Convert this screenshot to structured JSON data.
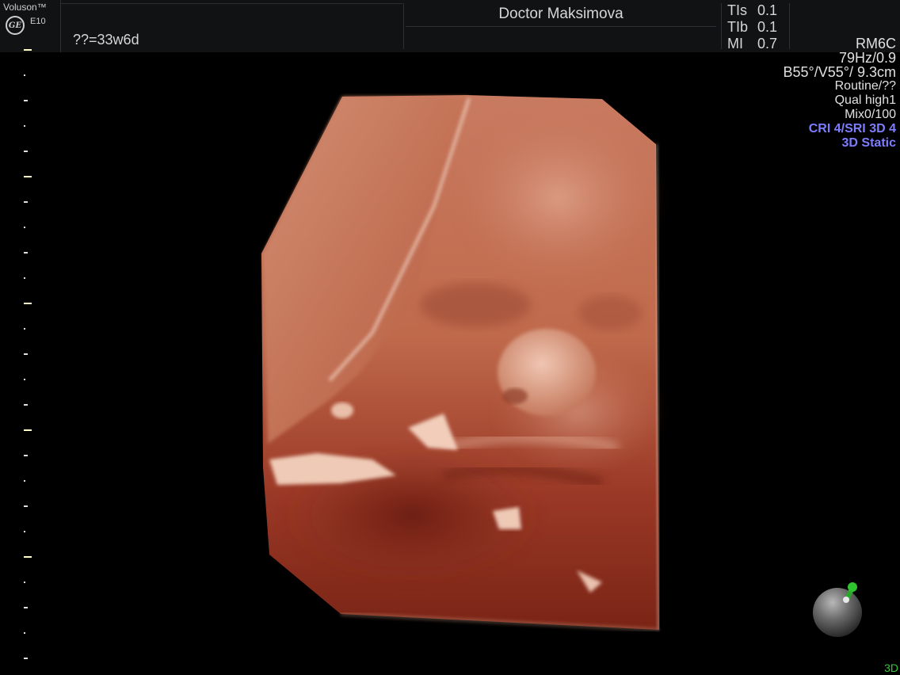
{
  "header": {
    "brand": "Voluson™",
    "model": "E10",
    "logo": "GE",
    "gestational_age": "??=33w6d",
    "operator": "Doctor Maksimova",
    "indices": [
      {
        "name": "TIs",
        "value": "0.1"
      },
      {
        "name": "TIb",
        "value": "0.1"
      },
      {
        "name": "MI",
        "value": "0.7"
      }
    ]
  },
  "info": {
    "probe": "RM6C",
    "frame": "79Hz/0.9",
    "angles": "B55°/V55°/ 9.3cm",
    "preset": "Routine/??",
    "quality": "Qual high1",
    "mix": "Mix0/100",
    "cri_sri": "CRI 4/SRI 3D 4",
    "render_mode": "3D Static"
  },
  "mode_tag": "3D",
  "icons": {
    "logo": "ge-logo-icon",
    "orientation": "orientation-ball-icon"
  },
  "colors": {
    "background": "#000000",
    "header": "#101214",
    "accent_blue": "#7d7dff",
    "accent_green": "#3ac43a"
  }
}
